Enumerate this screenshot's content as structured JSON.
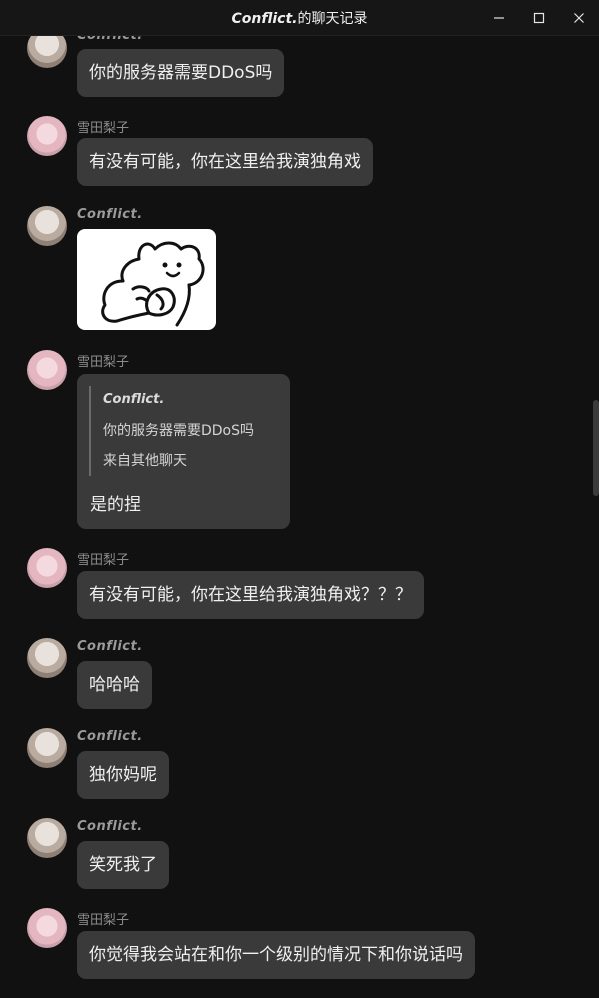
{
  "window": {
    "title_name": "Conflict.",
    "title_suffix": "的聊天记录"
  },
  "messages": [
    {
      "sender": "Conflict.",
      "text": "你的服务器需要DDoS吗"
    },
    {
      "sender": "雪田梨子",
      "text": "有没有可能，你在这里给我演独角戏"
    },
    {
      "sender": "Conflict.",
      "sticker": "bear-sticker"
    },
    {
      "sender": "雪田梨子",
      "quote": {
        "sender": "Conflict.",
        "text": "你的服务器需要DDoS吗",
        "source": "来自其他聊天"
      },
      "text": "是的捏"
    },
    {
      "sender": "雪田梨子",
      "text": "有没有可能，你在这里给我演独角戏？？？"
    },
    {
      "sender": "Conflict.",
      "text": "哈哈哈"
    },
    {
      "sender": "Conflict.",
      "text": "独你妈呢"
    },
    {
      "sender": "Conflict.",
      "text": "笑死我了"
    },
    {
      "sender": "雪田梨子",
      "text": "你觉得我会站在和你一个级别的情况下和你说话吗"
    }
  ],
  "icons": {
    "minimize": "minimize-icon",
    "maximize": "maximize-icon",
    "close": "close-icon"
  }
}
